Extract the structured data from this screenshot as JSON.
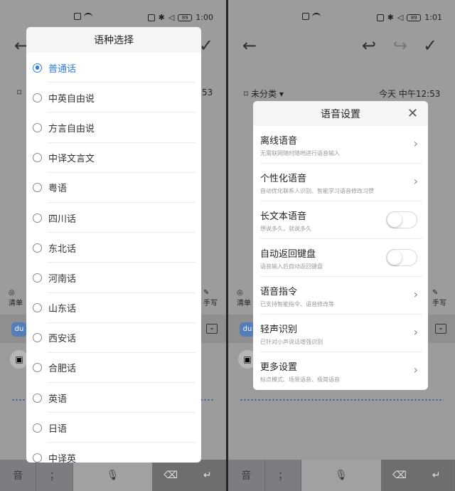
{
  "left": {
    "status": {
      "time": "1:00",
      "battery": "89"
    },
    "note_time_partial": "53",
    "language_dialog": {
      "title": "语种选择",
      "options": [
        {
          "label": "普通话",
          "selected": true
        },
        {
          "label": "中英自由说",
          "selected": false
        },
        {
          "label": "方言自由说",
          "selected": false
        },
        {
          "label": "中译文言文",
          "selected": false
        },
        {
          "label": "粤语",
          "selected": false
        },
        {
          "label": "四川话",
          "selected": false
        },
        {
          "label": "东北话",
          "selected": false
        },
        {
          "label": "河南话",
          "selected": false
        },
        {
          "label": "山东话",
          "selected": false
        },
        {
          "label": "西安话",
          "selected": false
        },
        {
          "label": "合肥话",
          "selected": false
        },
        {
          "label": "英语",
          "selected": false
        },
        {
          "label": "日语",
          "selected": false
        },
        {
          "label": "中译英",
          "selected": false
        }
      ]
    },
    "bottom_row": {
      "left_label": "清单",
      "right_label": "手写"
    },
    "keys": {
      "k1": "音",
      "k2": "；"
    }
  },
  "right": {
    "status": {
      "time": "1:01",
      "battery": "89"
    },
    "note": {
      "category": "未分类",
      "time": "今天 中午12:53"
    },
    "voice_dialog": {
      "title": "语音设置",
      "items": [
        {
          "title": "离线语音",
          "desc": "无需联网随时随地进行语音输入",
          "control": "chevron"
        },
        {
          "title": "个性化语音",
          "desc": "自动优化联系人识别、智能学习语音修改习惯",
          "control": "chevron"
        },
        {
          "title": "长文本语音",
          "desc": "想说多久，就说多久",
          "control": "toggle",
          "on": false
        },
        {
          "title": "自动返回键盘",
          "desc": "语音输入后自动返回键盘",
          "control": "toggle",
          "on": false
        },
        {
          "title": "语音指令",
          "desc": "已支持智能指令、语音修改等",
          "control": "chevron"
        },
        {
          "title": "轻声识别",
          "desc": "已针对小声说话增强识别",
          "control": "chevron"
        },
        {
          "title": "更多设置",
          "desc": "标点模式、场景语音、极简语音",
          "control": "chevron"
        }
      ]
    },
    "bottom_row": {
      "left_label": "清单",
      "right_label": "手写"
    },
    "keys": {
      "k1": "音",
      "k2": "；"
    }
  },
  "colors": {
    "accent": "#2e7ce0",
    "overlay": "#9c9c9c"
  },
  "du_logo": "du"
}
